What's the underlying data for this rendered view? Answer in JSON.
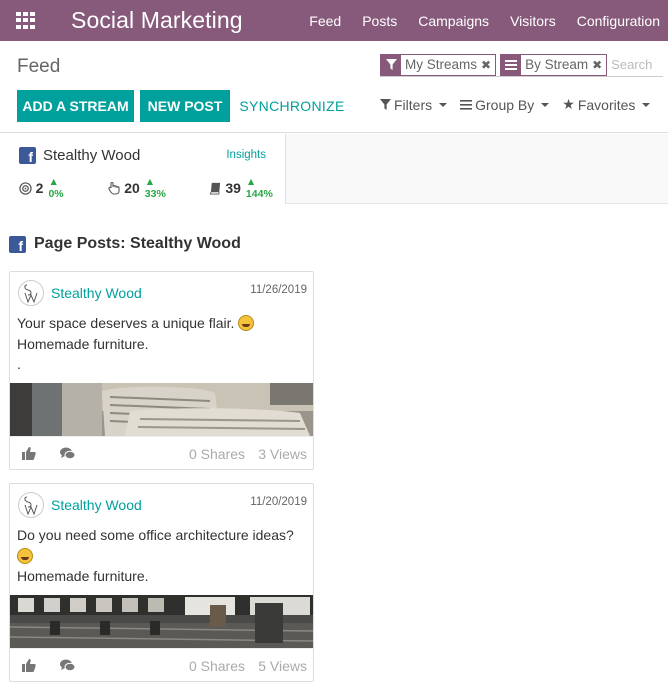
{
  "navbar": {
    "app_title": "Social Marketing",
    "menu": [
      "Feed",
      "Posts",
      "Campaigns",
      "Visitors",
      "Configuration"
    ]
  },
  "control_panel": {
    "breadcrumb": "Feed",
    "buttons": {
      "add_stream": "ADD A STREAM",
      "new_post": "NEW POST",
      "synchronize": "SYNCHRONIZE"
    },
    "search": {
      "facets": [
        {
          "icon": "filter-icon",
          "label": "My Streams"
        },
        {
          "icon": "list-icon",
          "label": "By Stream"
        }
      ],
      "placeholder": "Search"
    },
    "filters": {
      "filters_label": "Filters",
      "group_by_label": "Group By",
      "favorites_label": "Favorites"
    }
  },
  "account": {
    "name": "Stealthy Wood",
    "insights_label": "Insights",
    "stats": [
      {
        "icon": "target-icon",
        "value": "2",
        "trend": "0%"
      },
      {
        "icon": "hand-click-icon",
        "value": "20",
        "trend": "33%"
      },
      {
        "icon": "book-icon",
        "value": "39",
        "trend": "144%"
      }
    ]
  },
  "page_posts": {
    "title": "Page Posts: Stealthy Wood",
    "posts": [
      {
        "author": "Stealthy Wood",
        "date": "11/26/2019",
        "line1": "Your space deserves a unique flair.",
        "line2": "Homemade furniture.",
        "line3": ".",
        "shares": "0 Shares",
        "views": "3 Views"
      },
      {
        "author": "Stealthy Wood",
        "date": "11/20/2019",
        "line1": "Do you need some office architecture ideas?",
        "line2": "Homemade furniture.",
        "shares": "0 Shares",
        "views": "5 Views"
      }
    ]
  },
  "colors": {
    "brand": "#875a7b",
    "accent": "#00a09d",
    "facebook": "#3b5998",
    "positive": "#28a745"
  }
}
